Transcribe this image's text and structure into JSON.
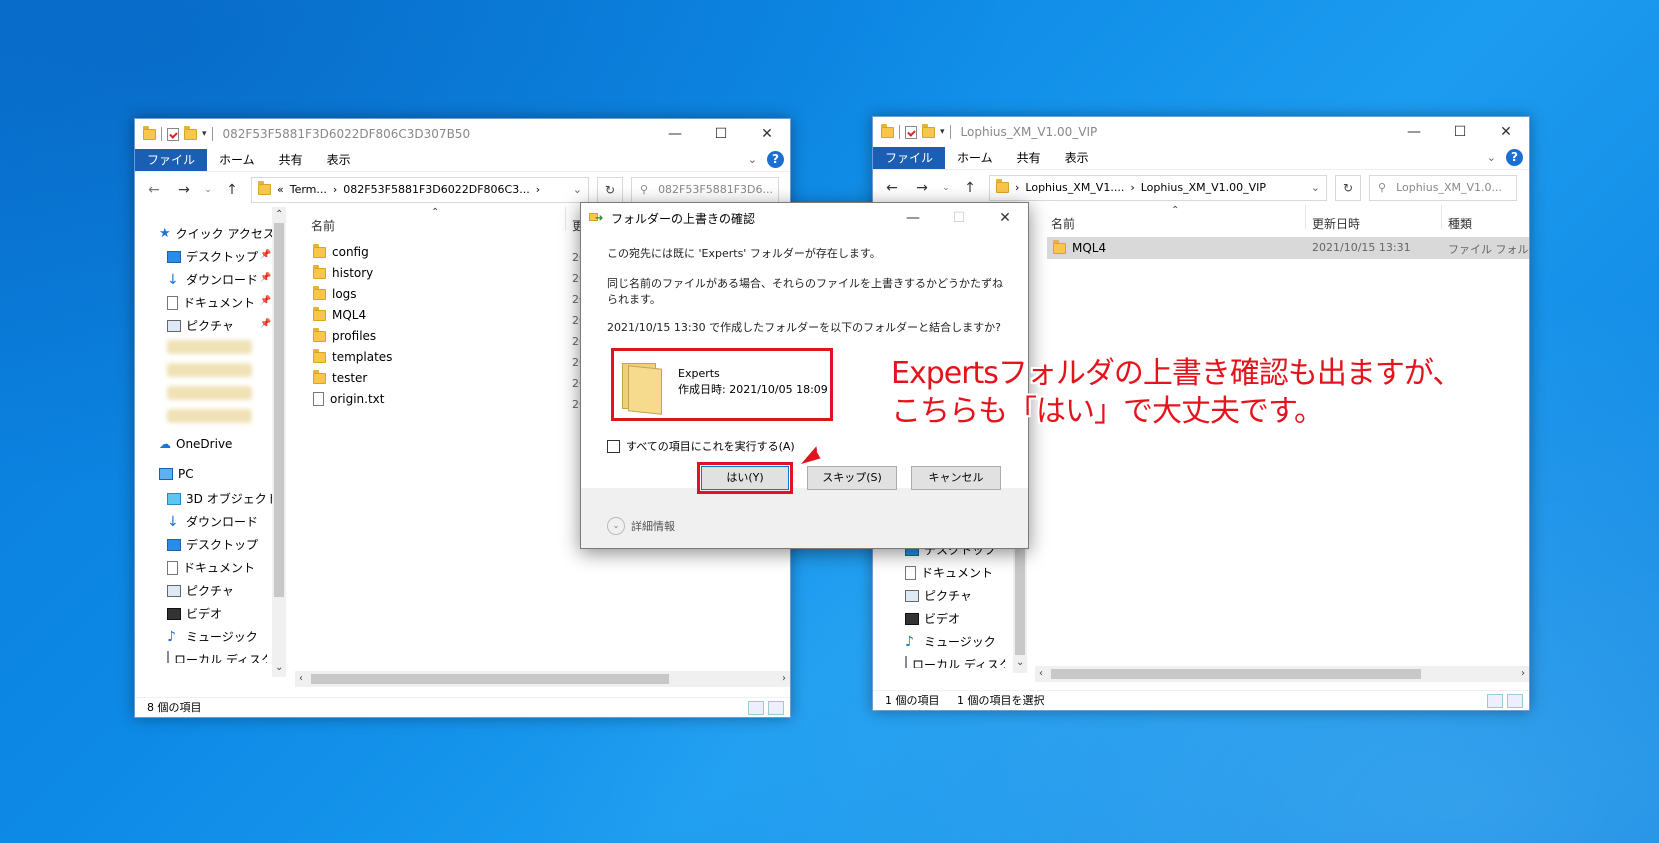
{
  "left_window": {
    "title": "082F53F5881F3D6022DF806C3D307B50",
    "ribbon_tabs": [
      "ファイル",
      "ホーム",
      "共有",
      "表示"
    ],
    "address": {
      "prefix": "«",
      "crumb1": "Term...",
      "crumb2": "082F53F5881F3D6022DF806C3...",
      "sep": "›"
    },
    "search_placeholder": "082F53F5881F3D6...",
    "nav": {
      "quick_access": "クイック アクセス",
      "desktop": "デスクトップ",
      "downloads": "ダウンロード",
      "documents": "ドキュメント",
      "pictures": "ピクチャ",
      "onedrive": "OneDrive",
      "pc": "PC",
      "objects3d": "3D オブジェクト",
      "pc_downloads": "ダウンロード",
      "pc_desktop": "デスクトップ",
      "pc_documents": "ドキュメント",
      "pc_pictures": "ピクチャ",
      "videos": "ビデオ",
      "music": "ミュージック",
      "local_disk": "ローカル ディスク (C"
    },
    "column_name": "名前",
    "column_date_partial": "更",
    "files": [
      {
        "name": "config",
        "type": "folder"
      },
      {
        "name": "history",
        "type": "folder"
      },
      {
        "name": "logs",
        "type": "folder"
      },
      {
        "name": "MQL4",
        "type": "folder"
      },
      {
        "name": "profiles",
        "type": "folder"
      },
      {
        "name": "templates",
        "type": "folder"
      },
      {
        "name": "tester",
        "type": "folder"
      },
      {
        "name": "origin.txt",
        "type": "file"
      }
    ],
    "date_partial": "20",
    "status": "8 個の項目"
  },
  "right_window": {
    "title": "Lophius_XM_V1.00_VIP",
    "ribbon_tabs": [
      "ファイル",
      "ホーム",
      "共有",
      "表示"
    ],
    "address": {
      "crumb1": "Lophius_XM_V1....",
      "crumb2": "Lophius_XM_V1.00_VIP",
      "sep": "›"
    },
    "search_placeholder": "Lophius_XM_V1.0...",
    "columns": {
      "name": "名前",
      "date": "更新日時",
      "type": "種類"
    },
    "row": {
      "name": "MQL4",
      "date": "2021/10/15 13:31",
      "type": "ファイル フォルダー"
    },
    "nav": {
      "desktop": "デスクトップ",
      "documents": "ドキュメント",
      "pictures": "ピクチャ",
      "videos": "ビデオ",
      "music": "ミュージック",
      "local_disk": "ローカル ディスク (C"
    },
    "status_count": "1 個の項目",
    "status_selected": "1 個の項目を選択"
  },
  "dialog": {
    "title": "フォルダーの上書きの確認",
    "line1": "この宛先には既に 'Experts' フォルダーが存在します。",
    "line2": "同じ名前のファイルがある場合、それらのファイルを上書きするかどうかたずねられます。",
    "line3": "2021/10/15 13:30 で作成したフォルダーを以下のフォルダーと結合しますか?",
    "folder_name": "Experts",
    "folder_created": "作成日時: 2021/10/05 18:09",
    "apply_all": "すべての項目にこれを実行する(A)",
    "yes": "はい(Y)",
    "skip": "スキップ(S)",
    "cancel": "キャンセル",
    "details": "詳細情報"
  },
  "callout": {
    "line1": "Expertsフォルダの上書き確認も出ますが、",
    "line2": "こちらも「はい」で大丈夫です。",
    "color": "#e4141c"
  }
}
